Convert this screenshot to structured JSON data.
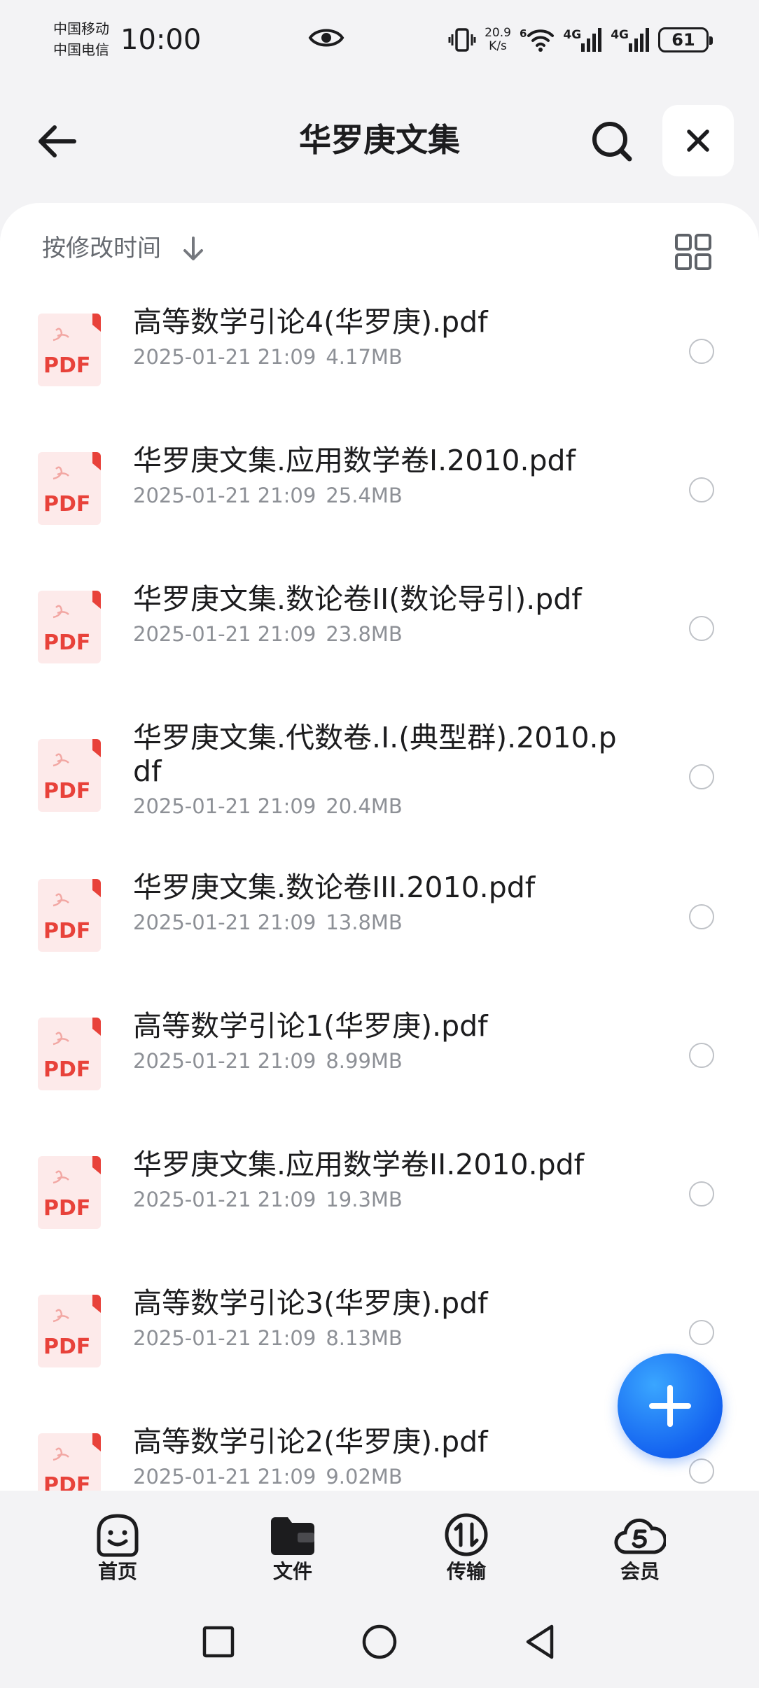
{
  "status_bar": {
    "carrier_1": "中国移动",
    "carrier_2": "中国电信",
    "time": "10:00",
    "net_speed_value": "20.9",
    "net_speed_unit": "K/s",
    "wifi_tag": "6",
    "signal_1": "4G",
    "signal_2": "4G",
    "battery": "61"
  },
  "header": {
    "title": "华罗庚文集"
  },
  "sort_bar": {
    "label": "按修改时间"
  },
  "files": [
    {
      "icon_label": "PDF",
      "name": "高等数学引论4(华罗庚).pdf",
      "date": "2025-01-21 21:09",
      "size": "4.17MB"
    },
    {
      "icon_label": "PDF",
      "name": "华罗庚文集.应用数学卷I.2010.pdf",
      "date": "2025-01-21 21:09",
      "size": "25.4MB"
    },
    {
      "icon_label": "PDF",
      "name": "华罗庚文集.数论卷II(数论导引).pdf",
      "date": "2025-01-21 21:09",
      "size": "23.8MB"
    },
    {
      "icon_label": "PDF",
      "name": "华罗庚文集.代数卷.I.(典型群).2010.pdf",
      "date": "2025-01-21 21:09",
      "size": "20.4MB"
    },
    {
      "icon_label": "PDF",
      "name": "华罗庚文集.数论卷III.2010.pdf",
      "date": "2025-01-21 21:09",
      "size": "13.8MB"
    },
    {
      "icon_label": "PDF",
      "name": "高等数学引论1(华罗庚).pdf",
      "date": "2025-01-21 21:09",
      "size": "8.99MB"
    },
    {
      "icon_label": "PDF",
      "name": "华罗庚文集.应用数学卷II.2010.pdf",
      "date": "2025-01-21 21:09",
      "size": "19.3MB"
    },
    {
      "icon_label": "PDF",
      "name": "高等数学引论3(华罗庚).pdf",
      "date": "2025-01-21 21:09",
      "size": "8.13MB"
    },
    {
      "icon_label": "PDF",
      "name": "高等数学引论2(华罗庚).pdf",
      "date": "2025-01-21 21:09",
      "size": "9.02MB"
    }
  ],
  "bottom_nav": {
    "home": "首页",
    "files": "文件",
    "transfer": "传输",
    "vip": "会员"
  },
  "colors": {
    "accent_blue": "#1463f0",
    "pdf_red": "#e8423a",
    "text_primary": "#1c1c1e",
    "text_secondary": "#8d9096"
  }
}
